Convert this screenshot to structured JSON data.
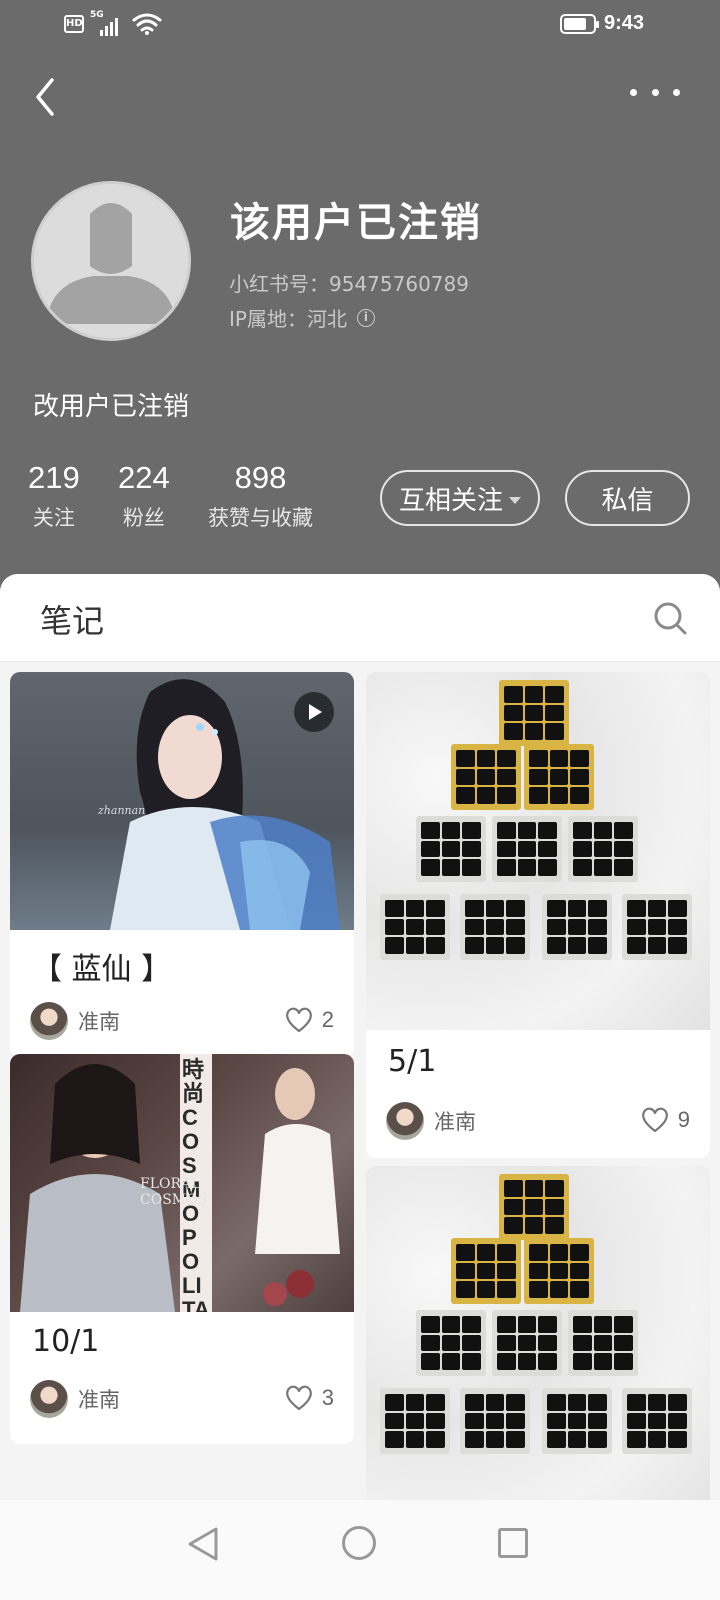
{
  "status_bar": {
    "hd": "HD",
    "network": "5G",
    "time": "9:43"
  },
  "profile": {
    "name": "该用户已注销",
    "redbook_id": "小红书号：95475760789",
    "ip_location": "IP属地：河北",
    "bio": "改用户已注销",
    "stats": [
      {
        "value": "219",
        "label": "关注"
      },
      {
        "value": "224",
        "label": "粉丝"
      },
      {
        "value": "898",
        "label": "获赞与收藏"
      }
    ],
    "follow_button": "互相关注",
    "message_button": "私信"
  },
  "tabs": {
    "notes": "笔记"
  },
  "notes": [
    {
      "title": "【 蓝仙 】",
      "author": "准南",
      "likes": "2",
      "has_video": true,
      "image_caption": "zhannan"
    },
    {
      "title": "5/1",
      "author": "准南",
      "likes": "9"
    },
    {
      "title": "10/1",
      "author": "准南",
      "likes": "3",
      "magazine_text": "時尚COSMOPOLITAN",
      "cover_text": "FLORAL COSMOS"
    },
    {
      "title": "",
      "author": "",
      "likes": ""
    }
  ],
  "colors": {
    "header_bg": "#6b6b6b",
    "panel_bg": "#f4f4f4",
    "gold": "#d7b443"
  }
}
